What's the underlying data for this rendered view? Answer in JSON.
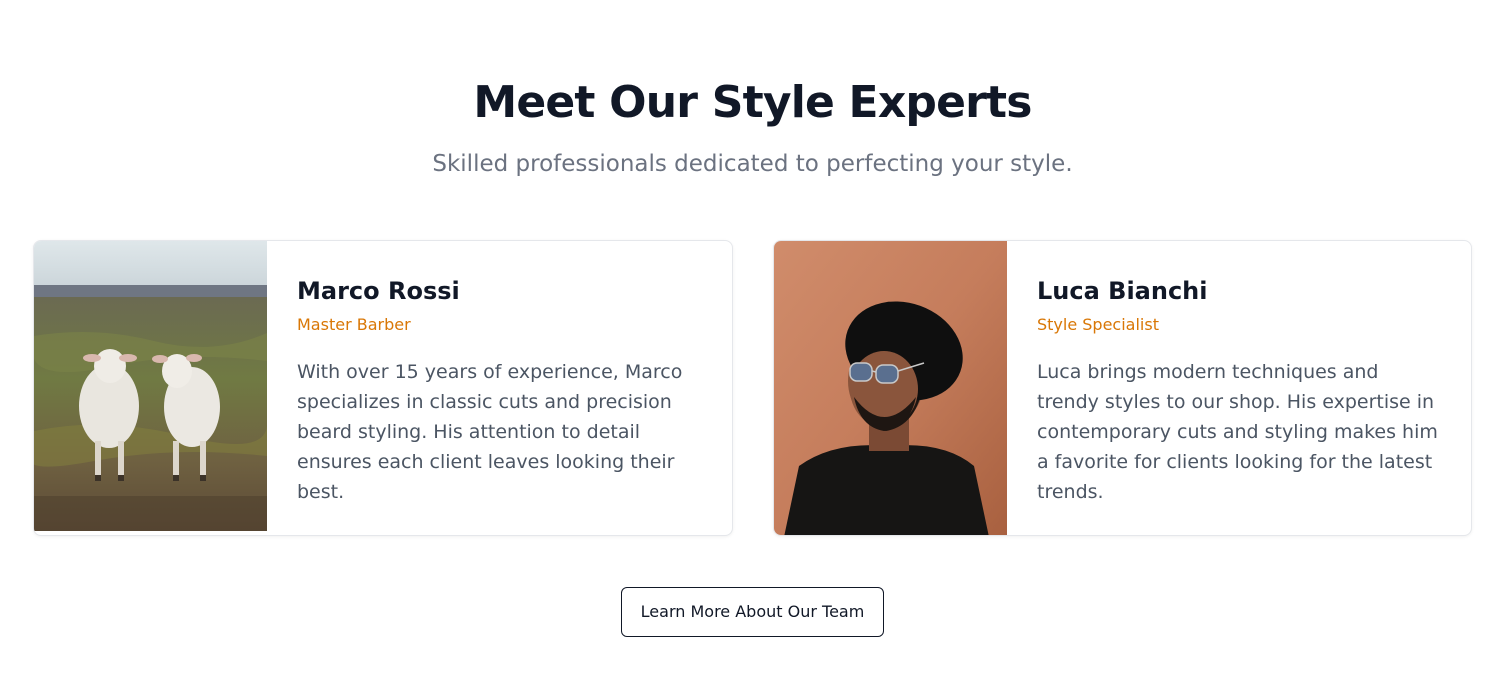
{
  "section": {
    "title": "Meet Our Style Experts",
    "subtitle": "Skilled professionals dedicated to perfecting your style."
  },
  "team": [
    {
      "name": "Marco Rossi",
      "role": "Master Barber",
      "bio": "With over 15 years of experience, Marco specializes in classic cuts and precision beard styling. His attention to detail ensures each client leaves looking their best.",
      "photo": "two-sheep-in-field-photo"
    },
    {
      "name": "Luca Bianchi",
      "role": "Style Specialist",
      "bio": "Luca brings modern techniques and trendy styles to our shop. His expertise in contemporary cuts and styling makes him a favorite for clients looking for the latest trends.",
      "photo": "man-in-hat-and-sunglasses-photo"
    }
  ],
  "cta": {
    "label": "Learn More About Our Team"
  },
  "colors": {
    "heading": "#111827",
    "subtitle": "#6b7280",
    "role_accent": "#d97706",
    "body_text": "#4b5563",
    "card_border": "#e5e7eb"
  }
}
